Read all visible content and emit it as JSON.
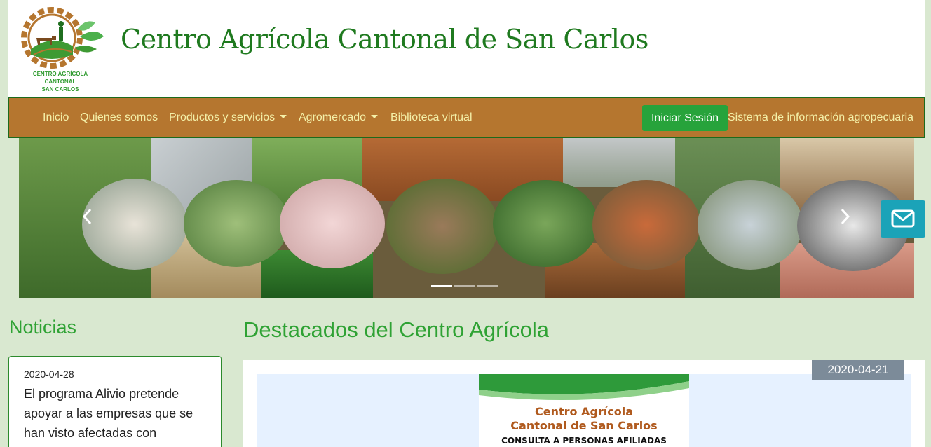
{
  "brand": {
    "logo_text_line1": "CENTRO AGRÍCOLA CANTONAL",
    "logo_text_line2": "SAN CARLOS",
    "site_title": "Centro Agrícola Cantonal de San Carlos"
  },
  "nav": {
    "items": [
      {
        "label": "Inicio"
      },
      {
        "label": "Quienes somos"
      },
      {
        "label": "Productos y servicios"
      },
      {
        "label": "Agromercado"
      },
      {
        "label": "Biblioteca virtual"
      }
    ],
    "login_label": "Iniciar Sesión",
    "sia_label": "Sistema de información agropecuaria"
  },
  "carousel": {
    "slide_count": 3,
    "active_index": 0
  },
  "contact": {
    "icon": "envelope-icon"
  },
  "news": {
    "title": "Noticias",
    "items": [
      {
        "date": "2020-04-28",
        "text": "El programa Alivio pretende apoyar a las empresas que se han visto afectadas con"
      }
    ]
  },
  "highlights": {
    "title": "Destacados del Centro Agrícola",
    "date": "2020-04-21",
    "feature_line1": "Centro Agrícola",
    "feature_line2": "Cantonal de San Carlos",
    "feature_line3": "CONSULTA A PERSONAS AFILIADAS"
  },
  "colors": {
    "page_bg": "#d9e8d0",
    "nav_bg": "#b5762f",
    "nav_text": "#f4f0a8",
    "brand_green": "#2fa234",
    "login_btn": "#27a33b",
    "contact_btn": "#1ba3b8",
    "date_badge": "#7c8b99"
  }
}
